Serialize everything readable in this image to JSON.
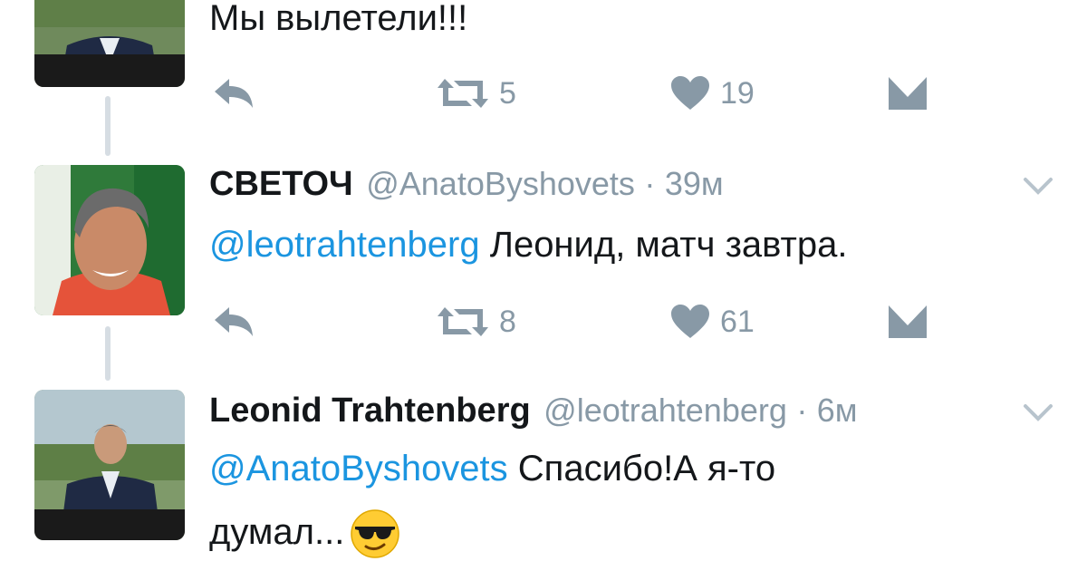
{
  "tweets": [
    {
      "text": "Мы вылетели!!!",
      "actions": {
        "retweets": "5",
        "likes": "19"
      }
    },
    {
      "name": "СВЕТОЧ",
      "handle": "@AnatoByshovets",
      "separator": "·",
      "time": "39м",
      "mention": "@leotrahtenberg",
      "text": " Леонид, матч завтра.",
      "actions": {
        "retweets": "8",
        "likes": "61"
      }
    },
    {
      "name": "Leonid Trahtenberg",
      "handle": "@leotrahtenberg",
      "separator": "·",
      "time": "6м",
      "mention": "@AnatoByshovets",
      "text": " Спасибо!А я-то",
      "text_line2": "думал...",
      "emoji": "smiling-face-with-sunglasses"
    }
  ],
  "icons": {
    "reply": "reply-icon",
    "retweet": "retweet-icon",
    "like": "heart-icon",
    "dm": "direct-message-icon",
    "caret": "chevron-down-icon"
  },
  "colors": {
    "mention": "#1b95e0",
    "secondary": "#8899a6",
    "thread_line": "#d6dde3",
    "text": "#14171a"
  }
}
